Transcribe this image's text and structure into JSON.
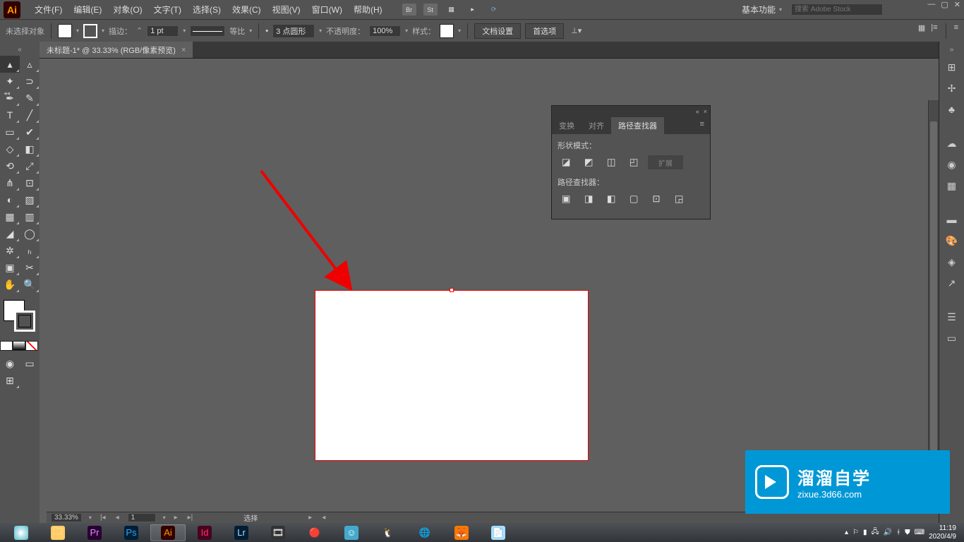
{
  "menubar": {
    "items": [
      "文件(F)",
      "编辑(E)",
      "对象(O)",
      "文字(T)",
      "选择(S)",
      "效果(C)",
      "视图(V)",
      "窗口(W)",
      "帮助(H)"
    ],
    "workspace": "基本功能",
    "search_placeholder": "搜索 Adobe Stock"
  },
  "optbar": {
    "status": "未选择对象",
    "stroke_label": "描边：",
    "stroke_weight": "1 pt",
    "profile": "等比",
    "brush": "3 点圆形",
    "opacity_label": "不透明度：",
    "opacity": "100%",
    "style_label": "样式：",
    "doc_setup": "文档设置",
    "prefs": "首选项"
  },
  "tab": {
    "title": "未标题-1* @ 33.33% (RGB/像素预览)"
  },
  "panel": {
    "tabs": [
      "变换",
      "对齐",
      "路径查找器"
    ],
    "shape_modes": "形状模式：",
    "pathfinders": "路径查找器：",
    "expand": "扩展"
  },
  "status": {
    "zoom": "33.33%",
    "artboard_nav": "1",
    "tool": "选择"
  },
  "taskbar": {
    "time": "11:19",
    "date": "2020/4/9"
  },
  "watermark": {
    "title": "溜溜自学",
    "url": "zixue.3d66.com"
  }
}
